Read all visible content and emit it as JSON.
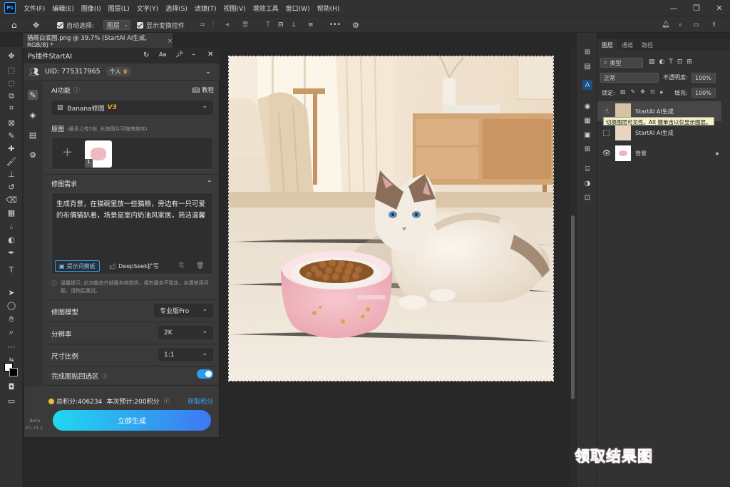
{
  "menu": {
    "items": [
      "文件(F)",
      "编辑(E)",
      "图像(I)",
      "图层(L)",
      "文字(Y)",
      "选择(S)",
      "滤镜(T)",
      "视图(V)",
      "增效工具",
      "窗口(W)",
      "帮助(H)"
    ],
    "logo": "Ps"
  },
  "options": {
    "auto_select_label": "自动选择:",
    "auto_select_value": "图层",
    "show_transform_label": "显示变换控件"
  },
  "document": {
    "tab_title": "猫碗白底图.png @ 39.7% (StartAI AI生成, RGB/8) *"
  },
  "plugin": {
    "title": "Ps插件StartAI",
    "uid_label": "UID: 775317965",
    "account_type": "个人",
    "ai_function_label": "AI功能",
    "tutorial_label": "教程",
    "model_select": "Banana修图",
    "model_version": "V3",
    "original_image_label": "原图",
    "original_image_hint": "(最多上传5张, 长按图片可拖拽排序)",
    "thumb_badge": "1",
    "requirement_label": "修图需求",
    "prompt_text": "生成背景，在猫碗里放一些猫粮，旁边有一只可爱的布偶猫趴着，场景是室内奶油风家居，简洁温馨",
    "prompt_template_btn": "提示词模板",
    "deepseek_btn": "DeepSeek扩写",
    "notice_text": "温馨提示: 此功能由外部服务商提供，偶有服务不稳定，如遇使用问题，请稍后重试。",
    "model_label": "修图模型",
    "model_value": "专业版Pro",
    "resolution_label": "分辨率",
    "resolution_value": "2K",
    "ratio_label": "尺寸比例",
    "ratio_value": "1:1",
    "paste_back_label": "完成图贴回选区",
    "paste_back_on": true,
    "points_total": "总积分:406234",
    "points_estimate": "本次预计:200积分",
    "get_points": "获取积分",
    "generate_btn": "立即生成",
    "beta_label": "Beta",
    "version_label": "V0.24.2"
  },
  "layers": {
    "tabs": [
      "图层",
      "通道",
      "路径"
    ],
    "filter_kind": "类型",
    "blend_mode": "正常",
    "opacity_label": "不透明度:",
    "opacity_value": "100%",
    "lock_label": "锁定:",
    "fill_label": "填充:",
    "fill_value": "100%",
    "items": [
      {
        "name": "StartAI AI生成"
      },
      {
        "name": "StartAI AI生成"
      },
      {
        "name": "背景"
      }
    ],
    "tooltip": "切换图层可见性。Alt 键单击以仅显示图层。"
  },
  "caption": "领取结果图",
  "colors": {
    "accent": "#31a8ff",
    "gradient_start": "#20d8f0",
    "gradient_end": "#3d78f2",
    "caption_red": "#ff1a1a",
    "toggle_blue": "#2b9cf0"
  }
}
